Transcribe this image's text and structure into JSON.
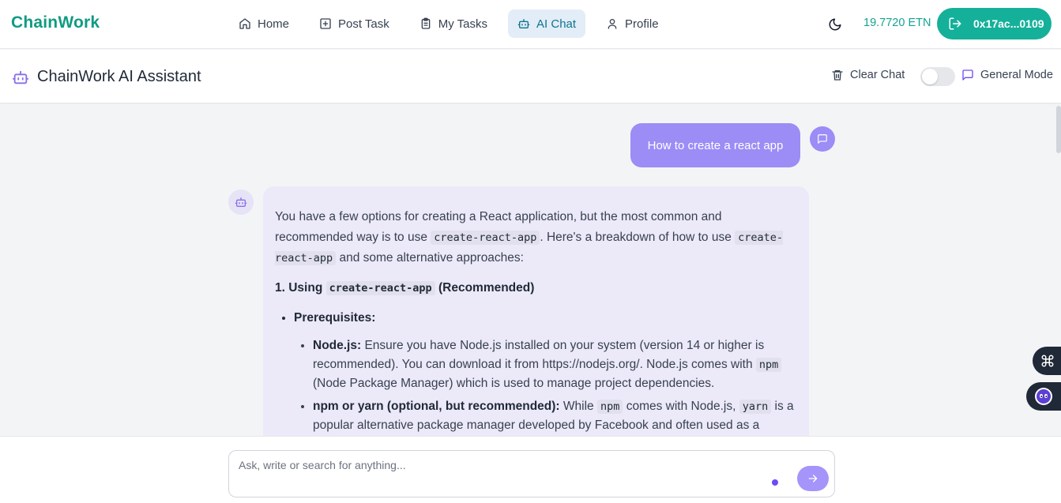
{
  "nav": {
    "brand": "ChainWork",
    "items": [
      {
        "label": "Home",
        "icon": "home-icon",
        "active": false
      },
      {
        "label": "Post Task",
        "icon": "plus-square-icon",
        "active": false
      },
      {
        "label": "My Tasks",
        "icon": "clipboard-icon",
        "active": false
      },
      {
        "label": "AI Chat",
        "icon": "bot-icon",
        "active": true
      },
      {
        "label": "Profile",
        "icon": "user-icon",
        "active": false
      }
    ],
    "balance": "19.7720 ETN",
    "wallet": "0x17ac...0109"
  },
  "chat_header": {
    "title": "ChainWork AI Assistant",
    "clear_label": "Clear Chat",
    "mode_label": "General Mode",
    "mode_toggle_on": false
  },
  "messages": {
    "user_text": "How to create a react app",
    "bot": {
      "intro_1": "You have a few options for creating a React application, but the most common and recommended way is to use",
      "code_cra": "create-react-app",
      "intro_2": ". Here's a breakdown of how to use",
      "intro_3": "and some alternative approaches:",
      "section_prefix": "1. Using",
      "section_suffix": "(Recommended)",
      "prereq_label": "Prerequisites:",
      "node_label": "Node.js:",
      "node_text_1": "Ensure you have Node.js installed on your system (version 14 or higher is recommended). You can download it from https://nodejs.org/. Node.js comes with",
      "code_npm": "npm",
      "node_text_2": "(Node Package Manager) which is used to manage project dependencies.",
      "npm_label": "npm or yarn (optional, but recommended):",
      "npm_text_1": "While",
      "npm_text_2": "comes with Node.js,",
      "code_yarn": "yarn",
      "npm_text_3": "is a popular alternative package manager developed by Facebook and often used as a"
    }
  },
  "input": {
    "placeholder": "Ask, write or search for anything..."
  },
  "colors": {
    "brand": "#0f9b82",
    "wallet_bg": "#15b09a",
    "user_bubble": "#9b8cf6",
    "bot_bubble": "#ece9f9",
    "active_nav": "#e3edf7"
  }
}
